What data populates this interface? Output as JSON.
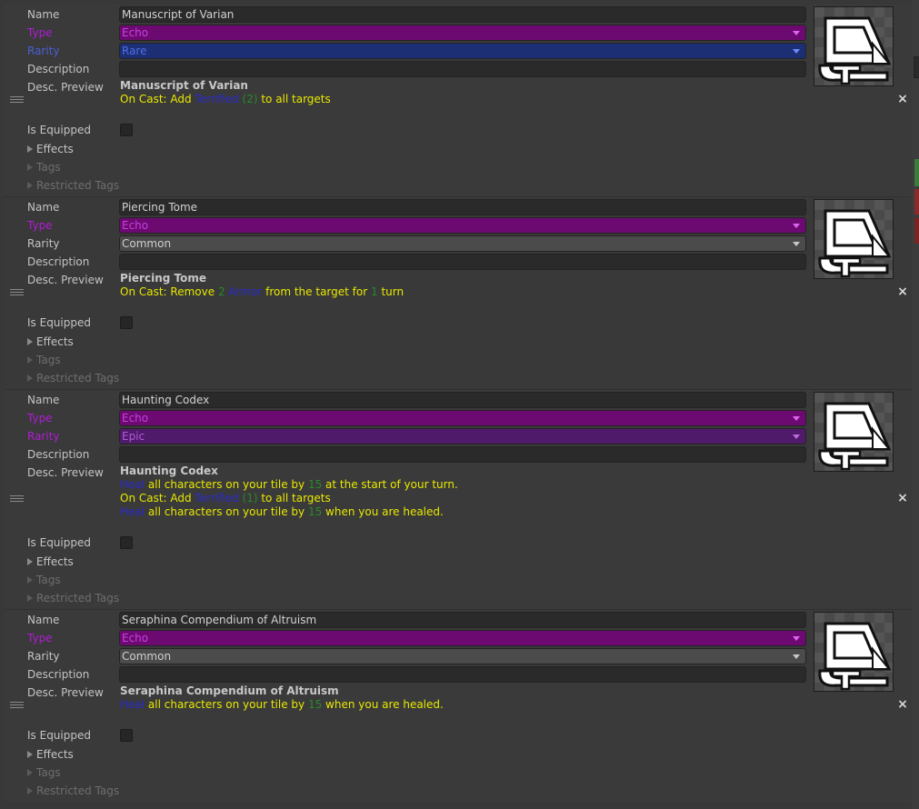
{
  "labels": {
    "name": "Name",
    "type": "Type",
    "rarity": "Rarity",
    "description": "Description",
    "desc_preview": "Desc. Preview",
    "is_equipped": "Is Equipped",
    "effects": "Effects",
    "tags": "Tags",
    "restricted_tags": "Restricted Tags"
  },
  "icons": {
    "drag_handle": "drag-handle-icon",
    "remove": "close-icon",
    "item_art": "tome-sprite-icon"
  },
  "remove_glyph": "×",
  "items": [
    {
      "name": "Manuscript of Varian",
      "type": "Echo",
      "rarity": "Rare",
      "description": "",
      "is_equipped": false,
      "preview_title": "Manuscript of Varian",
      "preview_lines": [
        [
          {
            "t": "On Cast: Add ",
            "c": "text"
          },
          {
            "t": "Terrified",
            "c": "kw"
          },
          {
            "t": " (2)",
            "c": "num"
          },
          {
            "t": " to all targets",
            "c": "text"
          }
        ]
      ]
    },
    {
      "name": "Piercing Tome",
      "type": "Echo",
      "rarity": "Common",
      "description": "",
      "is_equipped": false,
      "preview_title": "Piercing Tome",
      "preview_lines": [
        [
          {
            "t": "On Cast: Remove ",
            "c": "text"
          },
          {
            "t": "2",
            "c": "num"
          },
          {
            "t": " Armor",
            "c": "kw"
          },
          {
            "t": " from the target for ",
            "c": "text"
          },
          {
            "t": "1",
            "c": "num"
          },
          {
            "t": " turn",
            "c": "text"
          }
        ]
      ]
    },
    {
      "name": "Haunting Codex",
      "type": "Echo",
      "rarity": "Epic",
      "description": "",
      "is_equipped": false,
      "preview_title": "Haunting Codex",
      "preview_lines": [
        [
          {
            "t": "Heal",
            "c": "kw"
          },
          {
            "t": " all characters on your tile by ",
            "c": "text"
          },
          {
            "t": "15",
            "c": "num"
          },
          {
            "t": " at the start of your turn.",
            "c": "text"
          }
        ],
        [
          {
            "t": "On Cast: Add ",
            "c": "text"
          },
          {
            "t": "Terrified",
            "c": "kw"
          },
          {
            "t": " (1)",
            "c": "num"
          },
          {
            "t": " to all targets",
            "c": "text"
          }
        ],
        [
          {
            "t": "Heal",
            "c": "kw"
          },
          {
            "t": " all characters on your tile by ",
            "c": "text"
          },
          {
            "t": "15",
            "c": "num"
          },
          {
            "t": " when you are healed.",
            "c": "text"
          }
        ]
      ]
    },
    {
      "name": "Seraphina Compendium of Altruism",
      "type": "Echo",
      "rarity": "Common",
      "description": "",
      "is_equipped": false,
      "preview_title": "Seraphina Compendium of Altruism",
      "preview_lines": [
        [
          {
            "t": "Heal",
            "c": "kw"
          },
          {
            "t": " all characters on your tile by ",
            "c": "text"
          },
          {
            "t": "15",
            "c": "num"
          },
          {
            "t": " when you are healed.",
            "c": "text"
          }
        ]
      ]
    }
  ],
  "colors": {
    "type_echo": "#6c0a72",
    "rarity_rare": "#1c2e74",
    "rarity_epic": "#4f1a6a",
    "rarity_common": "#4b4b4b",
    "preview_text": "#e8e800",
    "keyword": "#2a2ad0",
    "number": "#2a8a2a"
  }
}
